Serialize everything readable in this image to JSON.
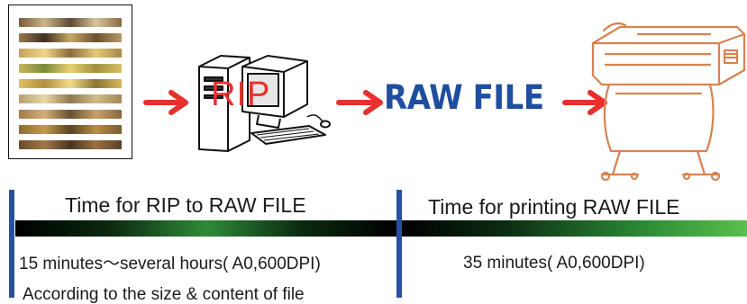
{
  "flow": {
    "step_rip_label": "RIP",
    "step_raw_label": "RAW FILE"
  },
  "timeline": {
    "left_heading": "Time for RIP to RAW FILE",
    "left_duration": "15 minutes～several hours( A0,600DPI)",
    "left_note": "According to the size & content of file",
    "right_heading": "Time for printing RAW FILE",
    "right_duration": "35 minutes( A0,600DPI)"
  },
  "colors": {
    "arrow": "#e8302c",
    "rip_text": "#e8302c",
    "raw_text": "#1f4e9e",
    "divider": "#2b4fa0",
    "printer_line": "#d98250",
    "bar_green": "#4caf50"
  }
}
